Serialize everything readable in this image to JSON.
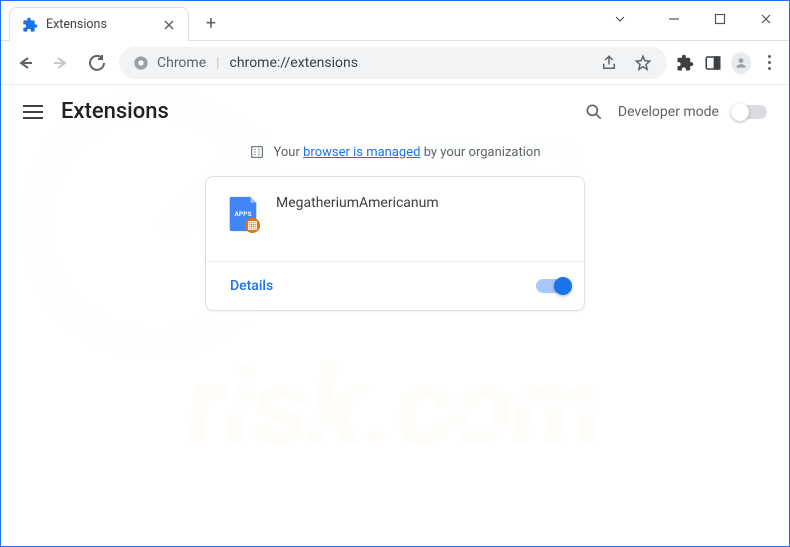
{
  "window": {
    "tab_title": "Extensions"
  },
  "omnibox": {
    "scheme": "Chrome",
    "path": "chrome://extensions"
  },
  "page": {
    "title": "Extensions",
    "developer_mode_label": "Developer mode",
    "managed_prefix": "Your",
    "managed_link": "browser is managed",
    "managed_suffix": "by your organization"
  },
  "extension": {
    "name": "MegatheriumAmericanum",
    "details_label": "Details",
    "icon_label": "APPS"
  }
}
